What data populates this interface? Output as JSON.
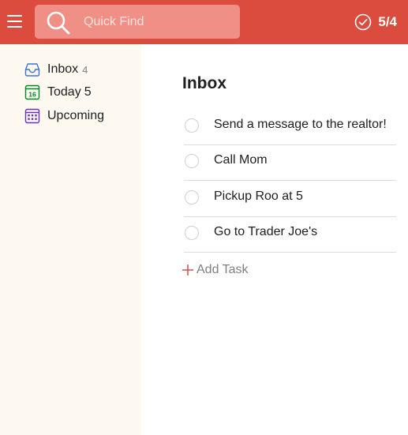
{
  "header": {
    "search": {
      "placeholder": "Quick Find",
      "value": ""
    },
    "karma": {
      "label": "5/4",
      "icon": "check-circle-icon"
    }
  },
  "sidebar": {
    "items": [
      {
        "label": "Inbox",
        "count": "4",
        "icon": "inbox-icon",
        "color": "#4073d6"
      },
      {
        "label": "Today",
        "count": "5",
        "icon": "calendar-today-icon",
        "icon_text": "16",
        "color": "#058527"
      },
      {
        "label": "Upcoming",
        "count": "",
        "icon": "calendar-upcoming-icon",
        "color": "#692fc2"
      }
    ]
  },
  "main": {
    "title": "Inbox",
    "tasks": [
      {
        "text": "Send a message to the realtor!"
      },
      {
        "text": "Call Mom"
      },
      {
        "text": "Pickup Roo at 5"
      },
      {
        "text": "Go to Trader Joe's"
      }
    ],
    "add_task_label": "Add Task"
  },
  "colors": {
    "brand": "#db4c3f",
    "search_bg": "#f08f86",
    "sidebar_bg": "#fdf9f1",
    "add_accent": "#db4c3f"
  }
}
